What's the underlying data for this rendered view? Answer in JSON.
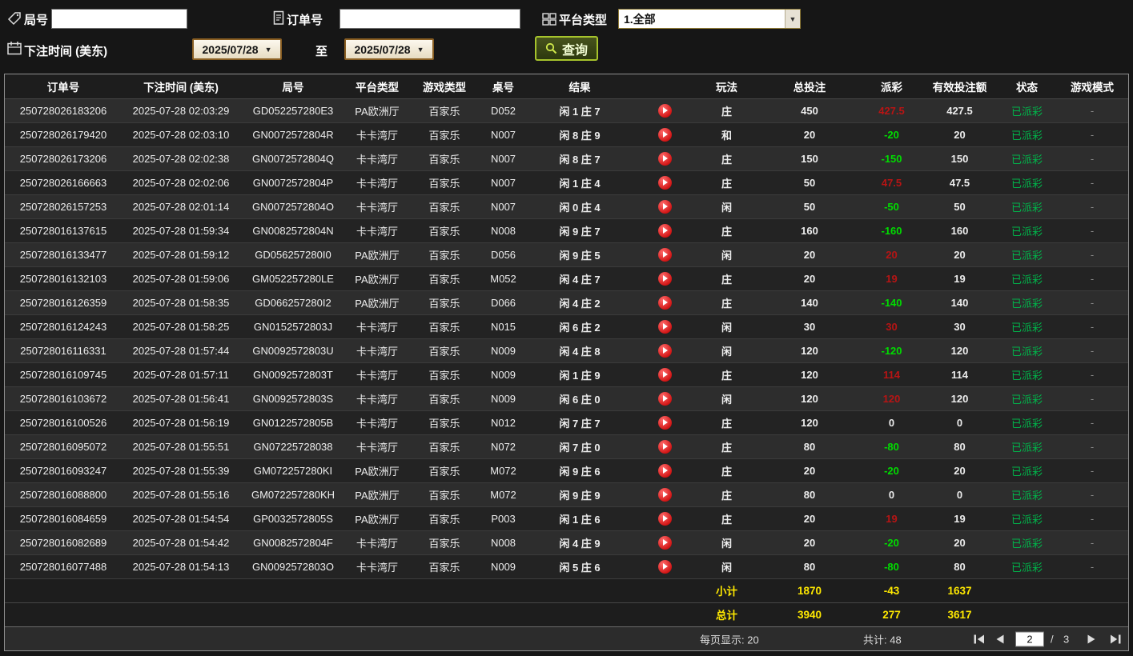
{
  "filters": {
    "round_label": "局号",
    "round_value": "",
    "order_label": "订单号",
    "order_value": "",
    "platform_label": "平台类型",
    "platform_value": "1.全部",
    "bet_time_label": "下注时间 (美东)",
    "date_from": "2025/07/28",
    "to_label": "至",
    "date_to": "2025/07/28",
    "search_label": "查询"
  },
  "icons": {
    "dropdown_arrow": "▼"
  },
  "table": {
    "headers": [
      "订单号",
      "下注时间 (美东)",
      "局号",
      "平台类型",
      "游戏类型",
      "桌号",
      "结果",
      "",
      "玩法",
      "总投注",
      "派彩",
      "有效投注额",
      "状态",
      "游戏模式"
    ],
    "rows": [
      [
        "250728026183206",
        "2025-07-28 02:03:29",
        "GD052257280E3",
        "PA欧洲厅",
        "百家乐",
        "D052",
        "闲 1 庄 7",
        "庄",
        "450",
        "427.5",
        "pos",
        "427.5",
        "已派彩",
        "-"
      ],
      [
        "250728026179420",
        "2025-07-28 02:03:10",
        "GN0072572804R",
        "卡卡湾厅",
        "百家乐",
        "N007",
        "闲 8 庄 9",
        "和",
        "20",
        "-20",
        "neg",
        "20",
        "已派彩",
        "-"
      ],
      [
        "250728026173206",
        "2025-07-28 02:02:38",
        "GN0072572804Q",
        "卡卡湾厅",
        "百家乐",
        "N007",
        "闲 8 庄 7",
        "庄",
        "150",
        "-150",
        "neg",
        "150",
        "已派彩",
        "-"
      ],
      [
        "250728026166663",
        "2025-07-28 02:02:06",
        "GN0072572804P",
        "卡卡湾厅",
        "百家乐",
        "N007",
        "闲 1 庄 4",
        "庄",
        "50",
        "47.5",
        "pos",
        "47.5",
        "已派彩",
        "-"
      ],
      [
        "250728026157253",
        "2025-07-28 02:01:14",
        "GN0072572804O",
        "卡卡湾厅",
        "百家乐",
        "N007",
        "闲 0 庄 4",
        "闲",
        "50",
        "-50",
        "neg",
        "50",
        "已派彩",
        "-"
      ],
      [
        "250728016137615",
        "2025-07-28 01:59:34",
        "GN0082572804N",
        "卡卡湾厅",
        "百家乐",
        "N008",
        "闲 9 庄 7",
        "庄",
        "160",
        "-160",
        "neg",
        "160",
        "已派彩",
        "-"
      ],
      [
        "250728016133477",
        "2025-07-28 01:59:12",
        "GD056257280I0",
        "PA欧洲厅",
        "百家乐",
        "D056",
        "闲 9 庄 5",
        "闲",
        "20",
        "20",
        "pos",
        "20",
        "已派彩",
        "-"
      ],
      [
        "250728016132103",
        "2025-07-28 01:59:06",
        "GM052257280LE",
        "PA欧洲厅",
        "百家乐",
        "M052",
        "闲 4 庄 7",
        "庄",
        "20",
        "19",
        "pos",
        "19",
        "已派彩",
        "-"
      ],
      [
        "250728016126359",
        "2025-07-28 01:58:35",
        "GD066257280I2",
        "PA欧洲厅",
        "百家乐",
        "D066",
        "闲 4 庄 2",
        "庄",
        "140",
        "-140",
        "neg",
        "140",
        "已派彩",
        "-"
      ],
      [
        "250728016124243",
        "2025-07-28 01:58:25",
        "GN0152572803J",
        "卡卡湾厅",
        "百家乐",
        "N015",
        "闲 6 庄 2",
        "闲",
        "30",
        "30",
        "pos",
        "30",
        "已派彩",
        "-"
      ],
      [
        "250728016116331",
        "2025-07-28 01:57:44",
        "GN0092572803U",
        "卡卡湾厅",
        "百家乐",
        "N009",
        "闲 4 庄 8",
        "闲",
        "120",
        "-120",
        "neg",
        "120",
        "已派彩",
        "-"
      ],
      [
        "250728016109745",
        "2025-07-28 01:57:11",
        "GN0092572803T",
        "卡卡湾厅",
        "百家乐",
        "N009",
        "闲 1 庄 9",
        "庄",
        "120",
        "114",
        "pos",
        "114",
        "已派彩",
        "-"
      ],
      [
        "250728016103672",
        "2025-07-28 01:56:41",
        "GN0092572803S",
        "卡卡湾厅",
        "百家乐",
        "N009",
        "闲 6 庄 0",
        "闲",
        "120",
        "120",
        "pos",
        "120",
        "已派彩",
        "-"
      ],
      [
        "250728016100526",
        "2025-07-28 01:56:19",
        "GN0122572805B",
        "卡卡湾厅",
        "百家乐",
        "N012",
        "闲 7 庄 7",
        "庄",
        "120",
        "0",
        "zero",
        "0",
        "已派彩",
        "-"
      ],
      [
        "250728016095072",
        "2025-07-28 01:55:51",
        "GN07225728038",
        "卡卡湾厅",
        "百家乐",
        "N072",
        "闲 7 庄 0",
        "庄",
        "80",
        "-80",
        "neg",
        "80",
        "已派彩",
        "-"
      ],
      [
        "250728016093247",
        "2025-07-28 01:55:39",
        "GM072257280KI",
        "PA欧洲厅",
        "百家乐",
        "M072",
        "闲 9 庄 6",
        "庄",
        "20",
        "-20",
        "neg",
        "20",
        "已派彩",
        "-"
      ],
      [
        "250728016088800",
        "2025-07-28 01:55:16",
        "GM072257280KH",
        "PA欧洲厅",
        "百家乐",
        "M072",
        "闲 9 庄 9",
        "庄",
        "80",
        "0",
        "zero",
        "0",
        "已派彩",
        "-"
      ],
      [
        "250728016084659",
        "2025-07-28 01:54:54",
        "GP0032572805S",
        "PA欧洲厅",
        "百家乐",
        "P003",
        "闲 1 庄 6",
        "庄",
        "20",
        "19",
        "pos",
        "19",
        "已派彩",
        "-"
      ],
      [
        "250728016082689",
        "2025-07-28 01:54:42",
        "GN0082572804F",
        "卡卡湾厅",
        "百家乐",
        "N008",
        "闲 4 庄 9",
        "闲",
        "20",
        "-20",
        "neg",
        "20",
        "已派彩",
        "-"
      ],
      [
        "250728016077488",
        "2025-07-28 01:54:13",
        "GN0092572803O",
        "卡卡湾厅",
        "百家乐",
        "N009",
        "闲 5 庄 6",
        "闲",
        "80",
        "-80",
        "neg",
        "80",
        "已派彩",
        "-"
      ]
    ]
  },
  "summary": {
    "subtotal_label": "小计",
    "subtotal_bet": "1870",
    "subtotal_payout": "-43",
    "subtotal_valid": "1637",
    "total_label": "总计",
    "total_bet": "3940",
    "total_payout": "277",
    "total_valid": "3617"
  },
  "pagination": {
    "per_page": "每页显示: 20",
    "total_count": "共计: 48",
    "current_page": "2",
    "page_separator": "/",
    "total_pages": "3"
  },
  "colors": {
    "payout_positive": "#b81414",
    "payout_negative": "#00dc00",
    "status_paid": "#00b44a",
    "summary_value": "#ffe900",
    "search_accent": "#a6c32c"
  }
}
